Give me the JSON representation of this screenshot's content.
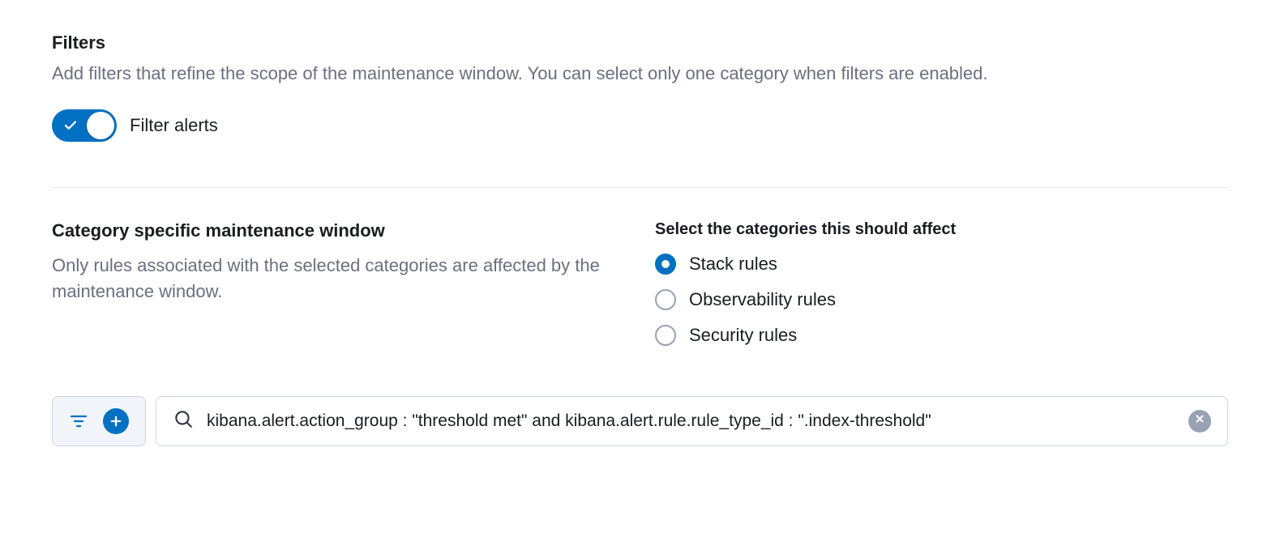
{
  "filters": {
    "title": "Filters",
    "description": "Add filters that refine the scope of the maintenance window. You can select only one category when filters are enabled.",
    "toggle_label": "Filter alerts",
    "toggle_on": true
  },
  "category": {
    "title": "Category specific maintenance window",
    "description": "Only rules associated with the selected categories are affected by the maintenance window.",
    "radio_group_title": "Select the categories this should affect",
    "options": [
      {
        "label": "Stack rules",
        "selected": true
      },
      {
        "label": "Observability rules",
        "selected": false
      },
      {
        "label": "Security rules",
        "selected": false
      }
    ]
  },
  "query": {
    "value": "kibana.alert.action_group : \"threshold met\" and kibana.alert.rule.rule_type_id : \".index-threshold\""
  }
}
